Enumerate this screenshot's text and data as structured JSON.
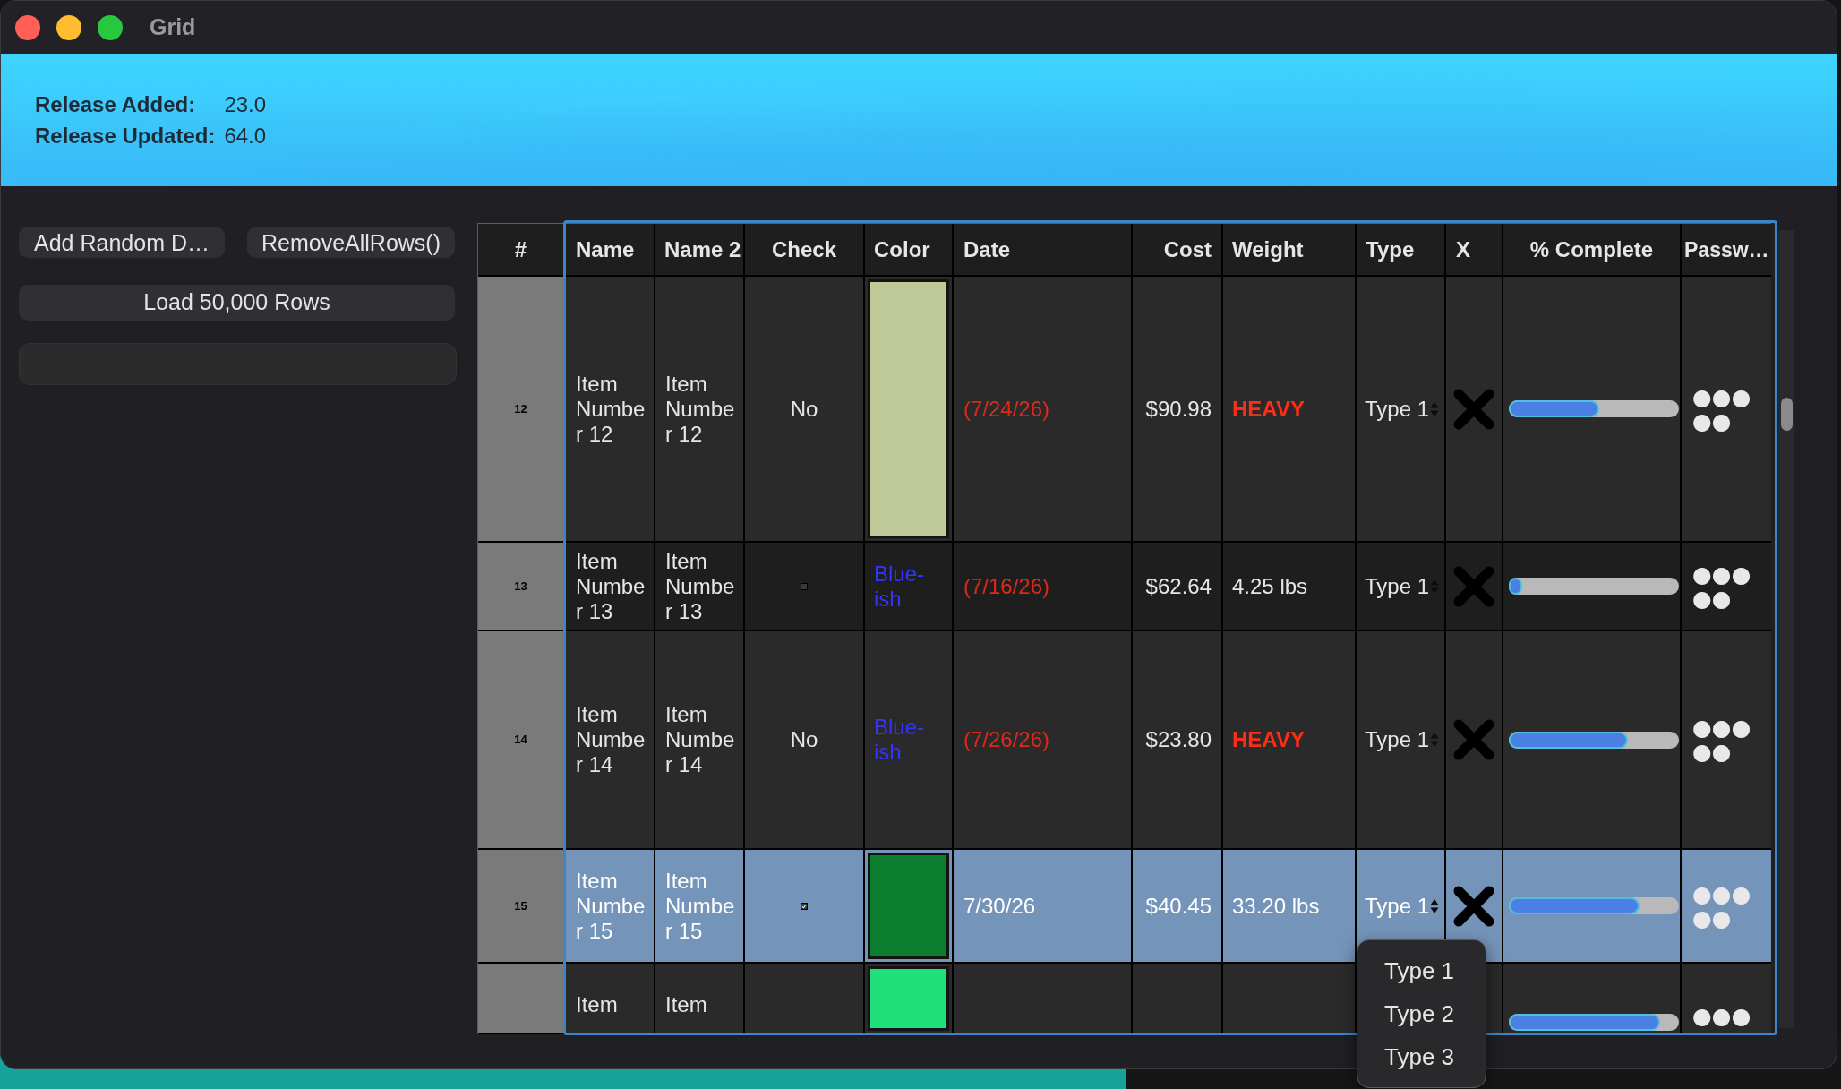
{
  "window": {
    "title": "Grid"
  },
  "release_info": [
    {
      "label": "Release Added:",
      "value": "23.0"
    },
    {
      "label": "Release Updated:",
      "value": "64.0"
    }
  ],
  "buttons": [
    {
      "label": "Add Random D…"
    },
    {
      "label": "RemoveAllRows()"
    },
    {
      "label": "Load 50,000 Rows"
    }
  ],
  "table": {
    "columns": [
      "#",
      "Name",
      "Name 2",
      "Check",
      "Color",
      "Date",
      "Cost",
      "Weight",
      "Type",
      "X",
      "% Complete",
      "Passw…"
    ],
    "rows": [
      {
        "number": "12",
        "name": "Item Number 12",
        "name_2": "Item Number 12",
        "check": {
          "kind": "text",
          "text": "No"
        },
        "color": {
          "kind": "swatch",
          "color": "#bfca98"
        },
        "date": {
          "text": "(7/24/26)",
          "flagged": true
        },
        "cost": "$90.98",
        "weight": {
          "text": "HEAVY",
          "flagged": true
        },
        "type": "Type 1",
        "level": 0.53,
        "password": "●●●●●",
        "selected": false
      },
      {
        "number": "13",
        "name": "Item Number 13",
        "name_2": "Item Number 13",
        "check": {
          "kind": "checkbox",
          "checked": false
        },
        "color": {
          "kind": "text",
          "text": "Blue-ish"
        },
        "date": {
          "text": "(7/16/26)",
          "flagged": true
        },
        "cost": "$62.64",
        "weight": {
          "text": "4.25 lbs",
          "flagged": false
        },
        "type": "Type 1",
        "level": 0.08,
        "password": "●●●●●",
        "selected": false
      },
      {
        "number": "14",
        "name": "Item Number 14",
        "name_2": "Item Number 14",
        "check": {
          "kind": "text",
          "text": "No"
        },
        "color": {
          "kind": "text",
          "text": "Blue-ish"
        },
        "date": {
          "text": "(7/26/26)",
          "flagged": true
        },
        "cost": "$23.80",
        "weight": {
          "text": "HEAVY",
          "flagged": true
        },
        "type": "Type 1",
        "level": 0.7,
        "password": "●●●●●",
        "selected": false
      },
      {
        "number": "15",
        "name": "Item Number 15",
        "name_2": "Item Number 15",
        "check": {
          "kind": "checkbox",
          "checked": true
        },
        "color": {
          "kind": "swatch",
          "color": "#0b7d2e"
        },
        "date": {
          "text": "7/30/26",
          "flagged": false
        },
        "cost": "$40.45",
        "weight": {
          "text": "33.20 lbs",
          "flagged": false
        },
        "type": "Type 1",
        "level": 0.77,
        "password": "●●●●●",
        "selected": true
      },
      {
        "name": "Item",
        "name_2": "Item",
        "color": {
          "kind": "swatch",
          "color": "#1fe07a"
        },
        "level": 0.89,
        "password": "●●●",
        "selected": false
      }
    ]
  },
  "type_menu": {
    "items": [
      "Type 1",
      "Type 2",
      "Type 3"
    ]
  }
}
